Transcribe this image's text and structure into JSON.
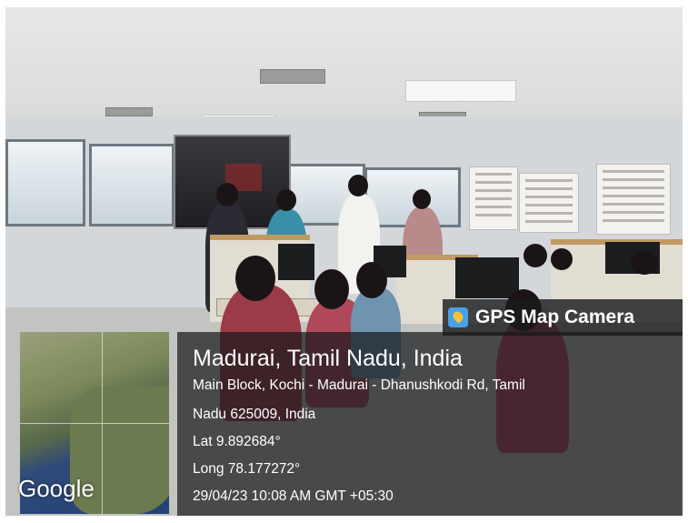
{
  "camera_badge": {
    "label": "GPS Map Camera",
    "icon": "map-pin-icon"
  },
  "location": {
    "title": "Madurai, Tamil Nadu, India",
    "address_line1": "Main Block, Kochi - Madurai - Dhanushkodi Rd, Tamil",
    "address_line2": "Nadu 625009, India",
    "latitude": "Lat 9.892684°",
    "longitude": "Long 78.177272°",
    "timestamp": "29/04/23 10:08 AM GMT +05:30"
  },
  "map": {
    "attribution": "Google"
  }
}
